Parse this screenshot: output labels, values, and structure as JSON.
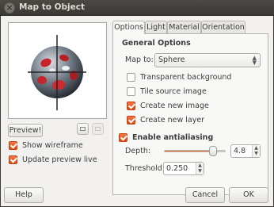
{
  "window": {
    "title": "Map to Object"
  },
  "preview": {
    "button_label": "Preview!"
  },
  "options_left": {
    "show_wireframe": {
      "label": "Show wireframe",
      "checked": true
    },
    "update_preview_live": {
      "label": "Update preview live",
      "checked": true
    }
  },
  "tabs": [
    {
      "label": "Options",
      "active": true
    },
    {
      "label": "Light",
      "active": false
    },
    {
      "label": "Material",
      "active": false
    },
    {
      "label": "Orientation",
      "active": false
    }
  ],
  "general": {
    "title": "General Options",
    "map_to_label": "Map to:",
    "map_to_value": "Sphere",
    "transparent_background": {
      "label": "Transparent background",
      "checked": false
    },
    "tile_source_image": {
      "label": "Tile source image",
      "checked": false
    },
    "create_new_image": {
      "label": "Create new image",
      "checked": true
    },
    "create_new_layer": {
      "label": "Create new layer",
      "checked": true
    }
  },
  "antialiasing": {
    "label": "Enable antialiasing",
    "checked": true,
    "depth_label": "Depth:",
    "depth_value": "4.8",
    "depth_fraction": 0.8,
    "threshold_label": "Threshold:",
    "threshold_value": "0.250"
  },
  "footer": {
    "help_label": "Help",
    "cancel_label": "Cancel",
    "ok_label": "OK"
  },
  "colors": {
    "accent": "#dd4814",
    "titlebar": "#3c3b37",
    "window_bg": "#f2f1f0"
  }
}
